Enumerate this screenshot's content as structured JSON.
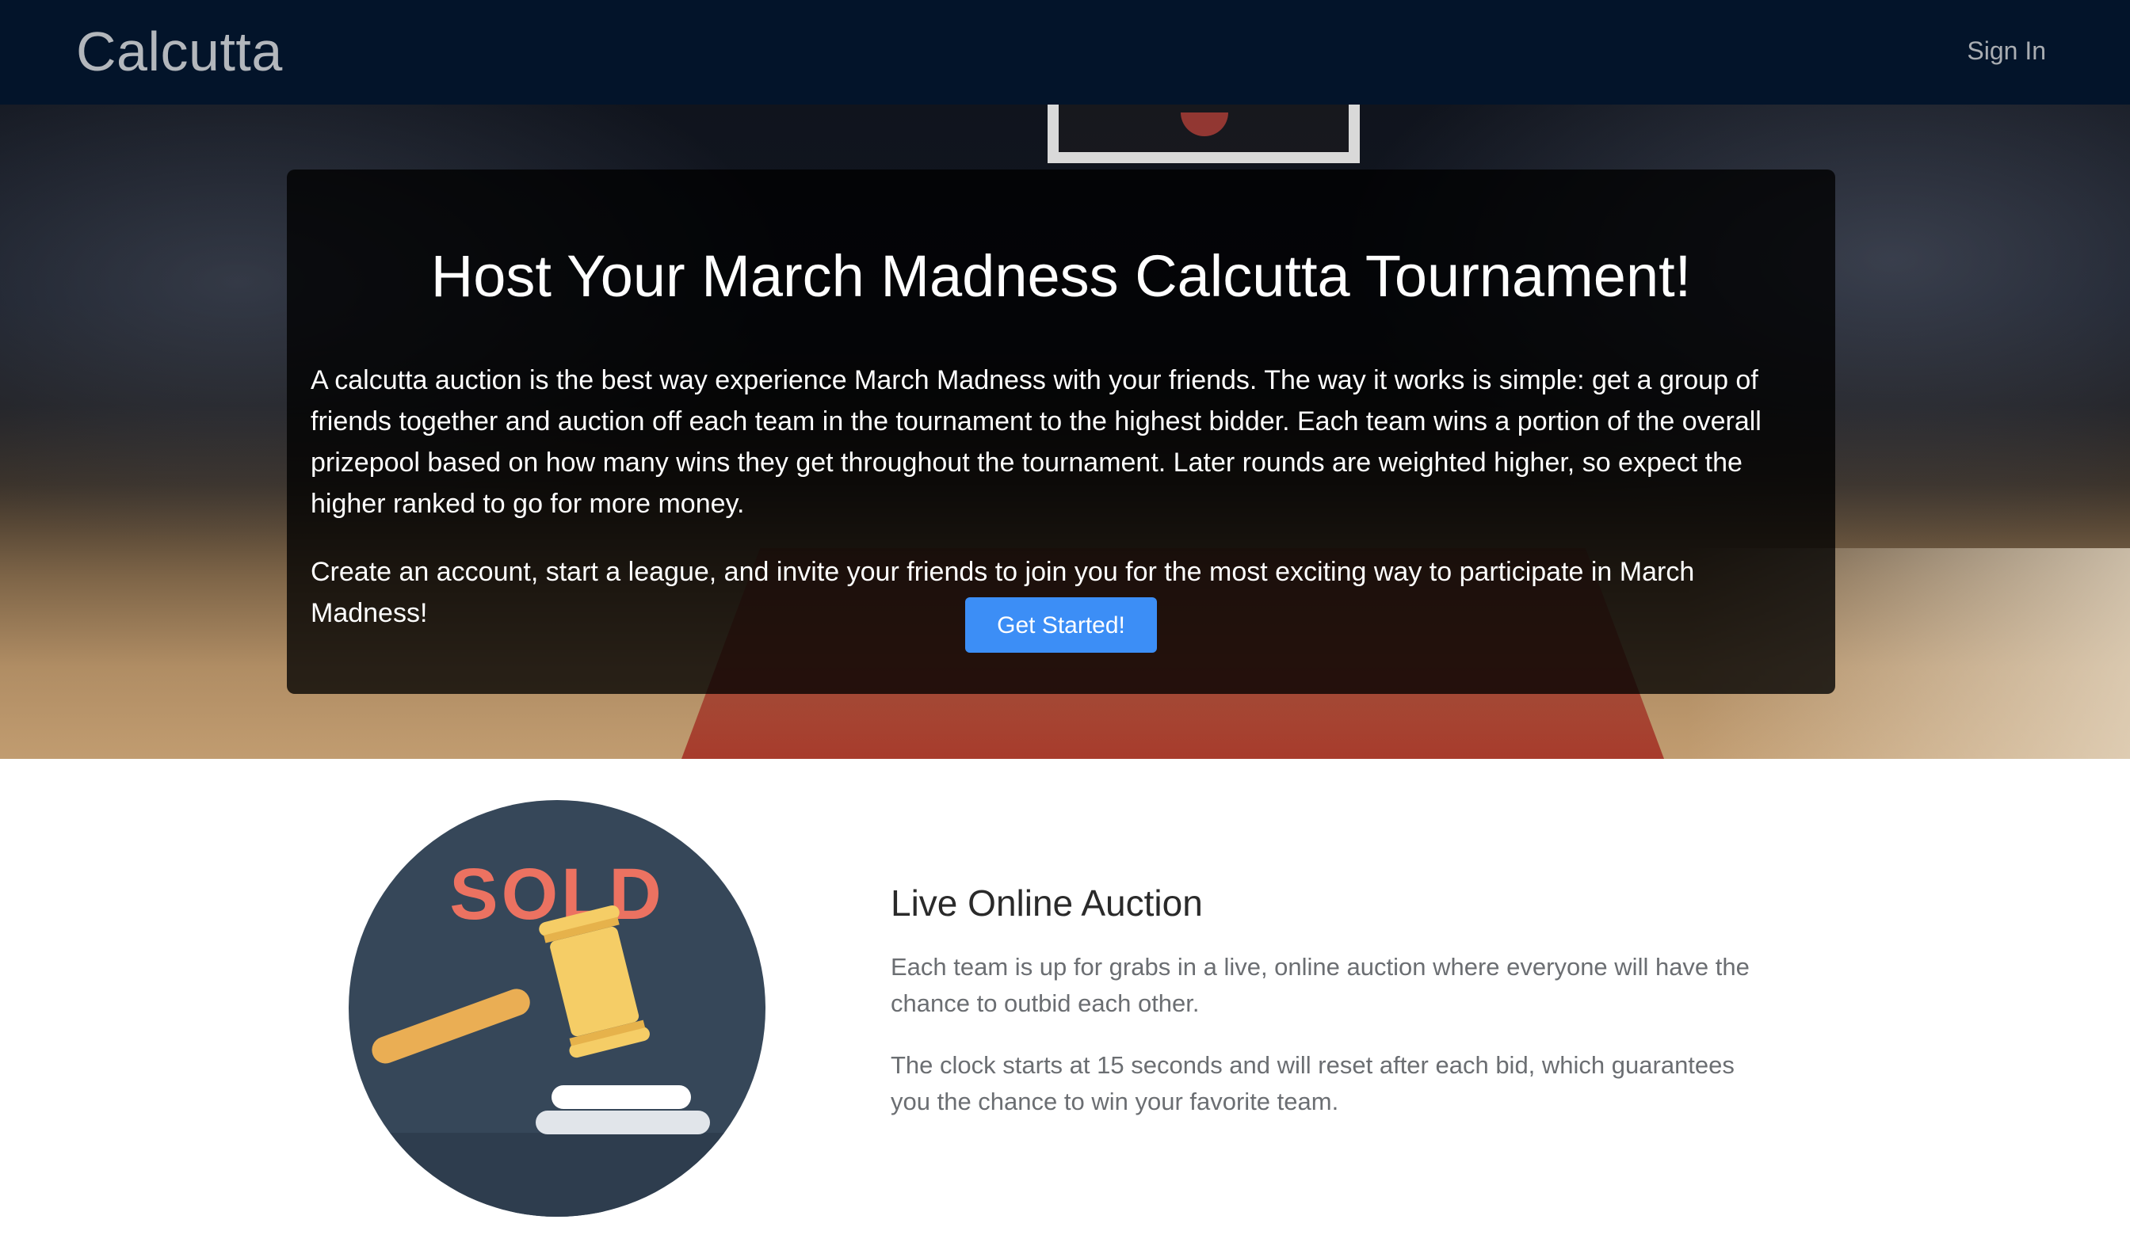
{
  "navbar": {
    "brand": "Calcutta",
    "sign_in": "Sign In"
  },
  "hero": {
    "title": "Host Your March Madness Calcutta Tournament!",
    "paragraph_1": "A calcutta auction is the best way experience March Madness with your friends. The way it works is simple: get a group of friends together and auction off each team in the tournament to the highest bidder. Each team wins a portion of the overall prizepool based on how many wins they get throughout the tournament. Later rounds are weighted higher, so expect the higher ranked to go for more money.",
    "paragraph_2": "Create an account, start a league, and invite your friends to join you for the most exciting way to participate in March Madness!",
    "cta_label": "Get Started!"
  },
  "feature": {
    "image_text": "SOLD",
    "image_icon": "gavel-icon",
    "heading": "Live Online Auction",
    "paragraph_1": "Each team is up for grabs in a live, online auction where everyone will have the chance to outbid each other.",
    "paragraph_2": "The clock starts at 15 seconds and will reset after each bid, which guarantees you the chance to win your favorite team."
  },
  "colors": {
    "navbar_bg": "#03142a",
    "cta_bg": "#3c8ef6",
    "sold_text": "#ec7261",
    "circle_bg": "#364759",
    "gavel": "#f5cd66"
  }
}
